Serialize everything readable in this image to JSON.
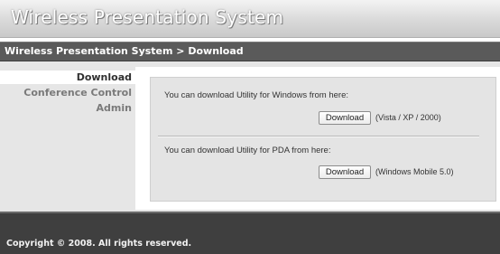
{
  "header": {
    "title": "Wireless Presentation System"
  },
  "breadcrumb": {
    "text": "Wireless Presentation System > Download"
  },
  "sidebar": {
    "items": [
      {
        "label": "Download",
        "active": true
      },
      {
        "label": "Conference Control",
        "active": false
      },
      {
        "label": "Admin",
        "active": false
      }
    ]
  },
  "main": {
    "windows": {
      "message": "You can download Utility for Windows from here:",
      "button_label": "Download",
      "note": "(Vista / XP / 2000)"
    },
    "pda": {
      "message": "You can download Utility for PDA from here:",
      "button_label": "Download",
      "note": "(Windows Mobile 5.0)"
    }
  },
  "footer": {
    "copyright": "Copyright © 2008. All rights reserved."
  },
  "colors": {
    "breadcrumb_bar": "#5a5a5a",
    "footer": "#3f3f3f",
    "panel": "#e4e4e4",
    "page_background": "#e6e6e6"
  }
}
